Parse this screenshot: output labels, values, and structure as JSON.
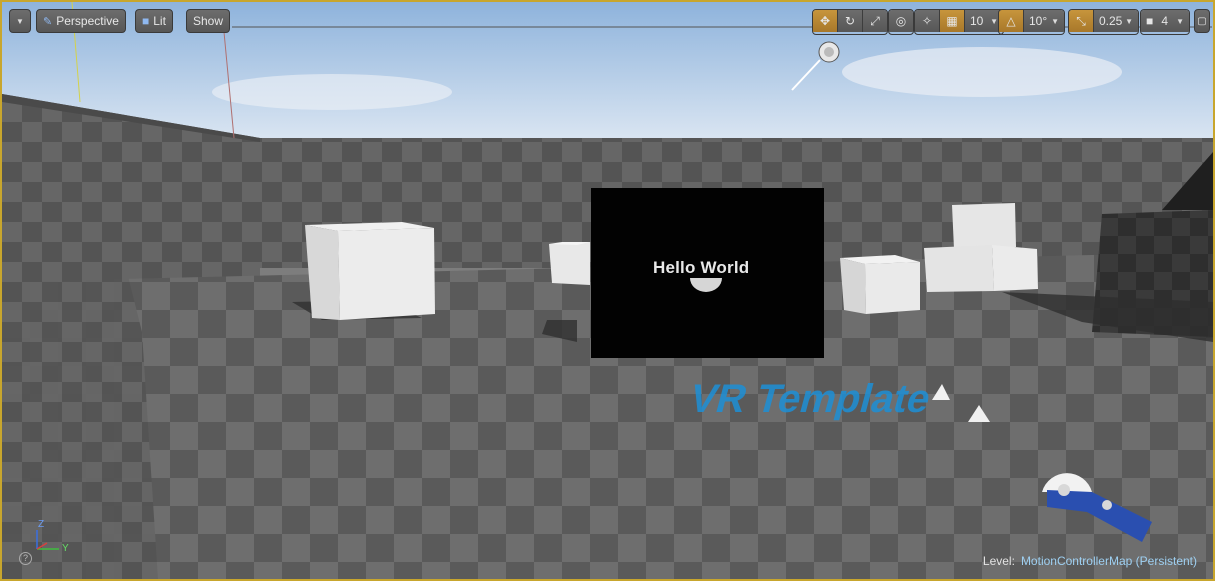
{
  "toolbar": {
    "view_mode_label": "Perspective",
    "lighting_label": "Lit",
    "show_label": "Show",
    "grid_snap_value": "10",
    "rotation_snap_value": "10°",
    "scale_snap_value": "0.25",
    "camera_speed_value": "4"
  },
  "scene": {
    "widget_text": "Hello World",
    "floor_text": "VR Template"
  },
  "axes": {
    "z_label": "Z",
    "y_label": "Y"
  },
  "status": {
    "level_label": "Level:",
    "level_name": "MotionControllerMap (Persistent)"
  },
  "colors": {
    "accent": "#c8a62d",
    "floor_text": "#1e8fd6",
    "level_name": "#9ed0f2"
  }
}
